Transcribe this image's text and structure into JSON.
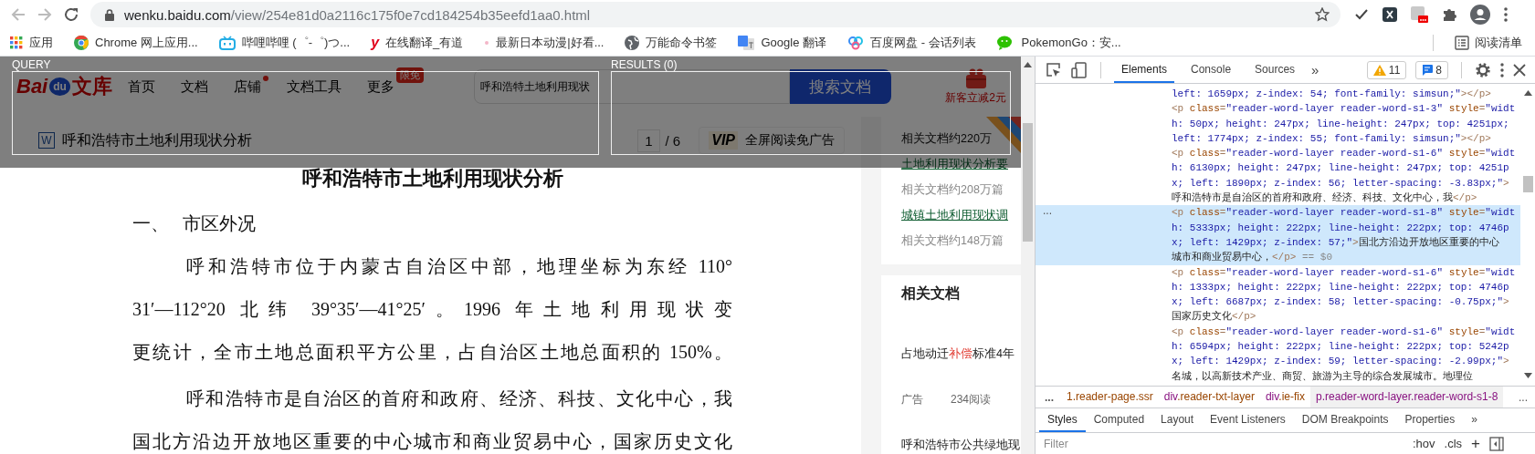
{
  "browser": {
    "address": {
      "host": "wenku.baidu.com",
      "path": "/view/254e81d0a2116c175f0e7cd184254b35eefd1aa0.html"
    },
    "bookmarks": [
      {
        "kind": "apps",
        "label": "应用"
      },
      {
        "kind": "chrome",
        "label": "Chrome 网上应用..."
      },
      {
        "kind": "tv",
        "label": "哔哩哔哩 (゜-゜)つ..."
      },
      {
        "kind": "letter",
        "glyph": "y",
        "label": "在线翻译_有道"
      },
      {
        "kind": "dot",
        "label": "最新日本动漫|好看..."
      },
      {
        "kind": "globe",
        "label": "万能命令书签"
      },
      {
        "kind": "translate",
        "label": "Google 翻译"
      },
      {
        "kind": "cloud",
        "label": "百度网盘 - 会话列表"
      },
      {
        "kind": "chat",
        "label": "PokemonGo：安..."
      }
    ],
    "reading_list": "阅读清单"
  },
  "overlay": {
    "query_label": "QUERY",
    "results_label": "RESULTS (0)"
  },
  "site_header": {
    "logo": {
      "left": "Bai",
      "mid": "du",
      "right": "文库"
    },
    "nav": [
      {
        "label": "首页",
        "dot": false
      },
      {
        "label": "文档",
        "dot": false
      },
      {
        "label": "店铺",
        "dot": true
      },
      {
        "label": "文档工具",
        "dot": false
      },
      {
        "label": "更多",
        "dot": false,
        "badge": "限免"
      }
    ],
    "search_value": "呼和浩特土地利用现状",
    "search_button": "搜索文档",
    "promo": "新客立减2元"
  },
  "doc_bar": {
    "icon_char": "W",
    "title": "呼和浩特市土地利用现状分析",
    "page": "1",
    "pages": "/ 6",
    "vip_logo": "VIP",
    "vip_label": "全屏阅读免广告"
  },
  "document": {
    "title": "呼和浩特市土地利用现状分析",
    "heading": {
      "number": "一、",
      "text": "市区外况"
    },
    "paragraphs": [
      {
        "lines": [
          "呼和浩特市位于内蒙古自治区中部，地理坐标为东经  110°",
          "31′—112°20 北纬 39°35′—41°25′。1996 年土地利用现状变",
          "更统计，全市土地总面积平方公里，占自治区土地总面积的 150%。"
        ]
      },
      {
        "lines": [
          "呼和浩特市是自治区的首府和政府、经济、科技、文化中心，我",
          "国北方沿边开放地区重要的中心城市和商业贸易中心，国家历史文化"
        ]
      }
    ]
  },
  "sidebar": {
    "cards": [
      {
        "items": [
          {
            "kind": "count",
            "text": "相关文档约220万"
          },
          {
            "kind": "link",
            "text": "土地利用现状分析要"
          },
          {
            "kind": "count",
            "text": "相关文档约208万篇"
          },
          {
            "kind": "link",
            "text": "城镇土地利用现状调"
          },
          {
            "kind": "count",
            "text": "相关文档约148万篇"
          }
        ]
      },
      {
        "title": "相关文档",
        "items": [
          {
            "kind": "doc",
            "segments": [
              {
                "text": "占地动迁",
                "highlight": false
              },
              {
                "text": "补偿",
                "highlight": true
              },
              {
                "text": "标准4年",
                "highlight": false
              }
            ]
          },
          {
            "kind": "meta",
            "tag": "广告",
            "reads": "234阅读"
          },
          {
            "kind": "doc",
            "segments": [
              {
                "text": "呼和浩特市公共绿地现",
                "highlight": false
              }
            ]
          }
        ]
      }
    ]
  },
  "devtools": {
    "tabs": [
      {
        "label": "Elements",
        "selected": true
      },
      {
        "label": "Console",
        "selected": false
      },
      {
        "label": "Sources",
        "selected": false
      }
    ],
    "more": "»",
    "warnings": "11",
    "messages": "8",
    "dom": {
      "gutter_marker": "...",
      "nodes": [
        {
          "selected": false,
          "lines": [
            [
              {
                "kind": "value",
                "text": "left: 1659px; z-index: 54; font-family: simsun;\""
              },
              {
                "kind": "tag",
                "text": "></p>"
              }
            ]
          ]
        },
        {
          "selected": false,
          "lines": [
            [
              {
                "kind": "tag",
                "text": "<p "
              },
              {
                "kind": "attr",
                "text": "class"
              },
              {
                "kind": "tag",
                "text": "="
              },
              {
                "kind": "value",
                "text": "\"reader-word-layer reader-word-s1-3\""
              },
              {
                "kind": "attr",
                "text": " style"
              },
              {
                "kind": "tag",
                "text": "="
              },
              {
                "kind": "value",
                "text": "\"widt"
              }
            ],
            [
              {
                "kind": "value",
                "text": "h: 50px; height: 247px; line-height: 247px; top: 4251px;"
              }
            ],
            [
              {
                "kind": "value",
                "text": "left: 1774px; z-index: 55; font-family: simsun;\""
              },
              {
                "kind": "tag",
                "text": "></p>"
              }
            ]
          ]
        },
        {
          "selected": false,
          "lines": [
            [
              {
                "kind": "tag",
                "text": "<p "
              },
              {
                "kind": "attr",
                "text": "class"
              },
              {
                "kind": "tag",
                "text": "="
              },
              {
                "kind": "value",
                "text": "\"reader-word-layer reader-word-s1-6\""
              },
              {
                "kind": "attr",
                "text": " style"
              },
              {
                "kind": "tag",
                "text": "="
              },
              {
                "kind": "value",
                "text": "\"widt"
              }
            ],
            [
              {
                "kind": "value",
                "text": "h: 6130px; height: 247px; line-height: 247px; top: 4251p"
              }
            ],
            [
              {
                "kind": "value",
                "text": "x; left: 1890px; z-index: 56; letter-spacing: -3.83px;\""
              },
              {
                "kind": "tag",
                "text": ">"
              }
            ],
            [
              {
                "kind": "text",
                "text": "呼和浩特市是自治区的首府和政府、经济、科技、文化中心，我"
              },
              {
                "kind": "tag",
                "text": "</p>"
              }
            ]
          ]
        },
        {
          "selected": true,
          "lines": [
            [
              {
                "kind": "tag",
                "text": "<p "
              },
              {
                "kind": "attr",
                "text": "class"
              },
              {
                "kind": "tag",
                "text": "="
              },
              {
                "kind": "value",
                "text": "\"reader-word-layer reader-word-s1-8\""
              },
              {
                "kind": "attr",
                "text": " style"
              },
              {
                "kind": "tag",
                "text": "="
              },
              {
                "kind": "value",
                "text": "\"widt"
              }
            ],
            [
              {
                "kind": "value",
                "text": "h: 5333px; height: 222px; line-height: 222px; top: 4746p"
              }
            ],
            [
              {
                "kind": "value",
                "text": "x; left: 1429px; z-index: 57;\""
              },
              {
                "kind": "tag",
                "text": ">"
              },
              {
                "kind": "text",
                "text": "国北方沿边开放地区重要的中心"
              }
            ],
            [
              {
                "kind": "text",
                "text": "城市和商业贸易中心，"
              },
              {
                "kind": "tag",
                "text": "</p>"
              },
              {
                "kind": "marker",
                "text": " == $0"
              }
            ]
          ]
        },
        {
          "selected": false,
          "lines": [
            [
              {
                "kind": "tag",
                "text": "<p "
              },
              {
                "kind": "attr",
                "text": "class"
              },
              {
                "kind": "tag",
                "text": "="
              },
              {
                "kind": "value",
                "text": "\"reader-word-layer reader-word-s1-6\""
              },
              {
                "kind": "attr",
                "text": " style"
              },
              {
                "kind": "tag",
                "text": "="
              },
              {
                "kind": "value",
                "text": "\"widt"
              }
            ],
            [
              {
                "kind": "value",
                "text": "h: 1333px; height: 222px; line-height: 222px; top: 4746p"
              }
            ],
            [
              {
                "kind": "value",
                "text": "x; left: 6687px; z-index: 58; letter-spacing: -0.75px;\""
              },
              {
                "kind": "tag",
                "text": ">"
              }
            ],
            [
              {
                "kind": "text",
                "text": "国家历史文化"
              },
              {
                "kind": "tag",
                "text": "</p>"
              }
            ]
          ]
        },
        {
          "selected": false,
          "lines": [
            [
              {
                "kind": "tag",
                "text": "<p "
              },
              {
                "kind": "attr",
                "text": "class"
              },
              {
                "kind": "tag",
                "text": "="
              },
              {
                "kind": "value",
                "text": "\"reader-word-layer reader-word-s1-6\""
              },
              {
                "kind": "attr",
                "text": " style"
              },
              {
                "kind": "tag",
                "text": "="
              },
              {
                "kind": "value",
                "text": "\"widt"
              }
            ],
            [
              {
                "kind": "value",
                "text": "h: 6594px; height: 222px; line-height: 222px; top: 5242p"
              }
            ],
            [
              {
                "kind": "value",
                "text": "x; left: 1429px; z-index: 59; letter-spacing: -2.99px;\""
              },
              {
                "kind": "tag",
                "text": ">"
              }
            ],
            [
              {
                "kind": "text",
                "text": "名城，以高新技术产业、商贸、旅游为主导的综合发展城市。地理位"
              }
            ]
          ]
        }
      ]
    },
    "breadcrumbs": {
      "left_more": "...",
      "right_more": "...",
      "items": [
        {
          "cls": "1.reader-page.ssr",
          "selected": false
        },
        {
          "tag": "div",
          "cls": ".reader-txt-layer",
          "selected": false
        },
        {
          "tag": "div",
          "cls": ".ie-fix",
          "selected": false
        },
        {
          "tag": "p",
          "cls": ".reader-word-layer.reader-word-s1-8",
          "selected": true
        }
      ]
    },
    "panes": [
      {
        "label": "Styles",
        "selected": true
      },
      {
        "label": "Computed",
        "selected": false
      },
      {
        "label": "Layout",
        "selected": false
      },
      {
        "label": "Event Listeners",
        "selected": false
      },
      {
        "label": "DOM Breakpoints",
        "selected": false
      },
      {
        "label": "Properties",
        "selected": false
      }
    ],
    "pane_more": "»",
    "filter": {
      "placeholder": "Filter",
      "hov": ":hov",
      "cls": ".cls",
      "plus": "+"
    }
  }
}
